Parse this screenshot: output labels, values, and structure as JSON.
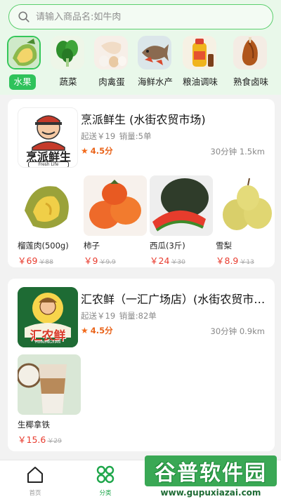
{
  "search": {
    "placeholder": "请输入商品名:如牛肉"
  },
  "categories": [
    {
      "label": "水果",
      "active": true
    },
    {
      "label": "蔬菜"
    },
    {
      "label": "肉禽蛋"
    },
    {
      "label": "海鲜水产"
    },
    {
      "label": "粮油调味"
    },
    {
      "label": "熟食卤味"
    }
  ],
  "stores": [
    {
      "name": "烹派鲜生 (水街农贸市场)",
      "logo_text": "烹派鲜生",
      "logo_sub": "Fresh Life",
      "min_order": "起送￥19",
      "sales": "销量:5单",
      "rating": "4.5分",
      "distance": "30分钟 1.5km",
      "products": [
        {
          "name": "榴莲肉(500g)",
          "price": "￥69",
          "old_price": "￥88"
        },
        {
          "name": "柿子",
          "price": "￥9",
          "old_price": "￥9.9"
        },
        {
          "name": "西瓜(3斤)",
          "price": "￥24",
          "old_price": "￥30"
        },
        {
          "name": "雪梨",
          "price": "￥8.9",
          "old_price": "￥13"
        }
      ]
    },
    {
      "name": "汇农鲜（一汇广场店）(水街农贸市场)",
      "logo_text": "汇农鲜",
      "logo_sub": "HUINONGXIAN",
      "min_order": "起送￥19",
      "sales": "销量:82单",
      "rating": "4.5分",
      "distance": "30分钟 0.9km",
      "products": [
        {
          "name": "生椰拿铁",
          "price": "￥15.6",
          "old_price": "￥29"
        }
      ]
    }
  ],
  "tabs": [
    {
      "label": "首页",
      "active": false
    },
    {
      "label": "分类",
      "active": true
    }
  ],
  "watermark": {
    "title": "谷普软件园",
    "url": "www.gupuxiazai.com"
  },
  "colors": {
    "accent": "#2fc25b",
    "price": "#e83b2e",
    "rating": "#f26a1b"
  }
}
